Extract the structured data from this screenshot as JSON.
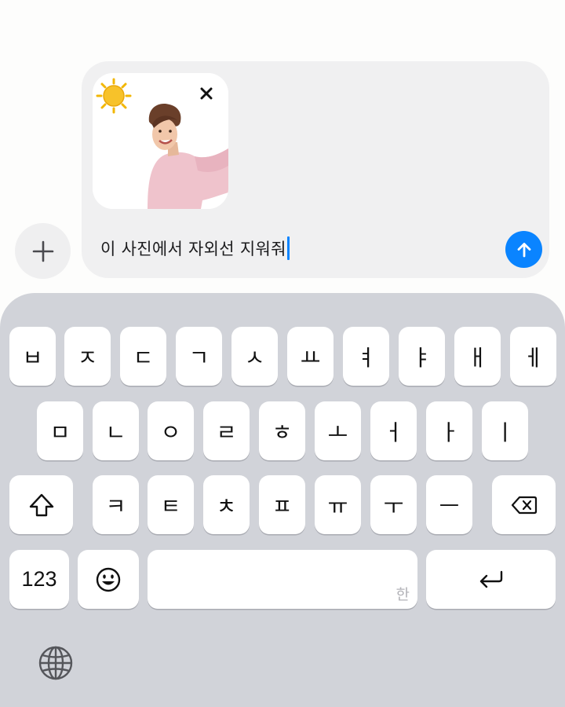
{
  "composer": {
    "message_text": "이 사진에서 자외선 지워줘"
  },
  "keyboard": {
    "row1": [
      "ㅂ",
      "ㅈ",
      "ㄷ",
      "ㄱ",
      "ㅅ",
      "ㅛ",
      "ㅕ",
      "ㅑ",
      "ㅐ",
      "ㅔ"
    ],
    "row2": [
      "ㅁ",
      "ㄴ",
      "ㅇ",
      "ㄹ",
      "ㅎ",
      "ㅗ",
      "ㅓ",
      "ㅏ",
      "ㅣ"
    ],
    "row3": [
      "ㅋ",
      "ㅌ",
      "ㅊ",
      "ㅍ",
      "ㅠ",
      "ㅜ",
      "ㅡ"
    ],
    "numbers_label": "123",
    "space_hint": "한"
  },
  "icons": {
    "add": "plus-icon",
    "attachment_badge": "sun-icon",
    "remove": "close-icon",
    "send": "arrow-up-icon",
    "shift": "shift-icon",
    "delete": "backspace-icon",
    "emoji": "emoji-icon",
    "return": "return-icon",
    "language": "globe-icon"
  },
  "colors": {
    "accent": "#0a84ff",
    "keyboard_bg": "#d1d3d9",
    "composer_bg": "#f0f0f1"
  }
}
